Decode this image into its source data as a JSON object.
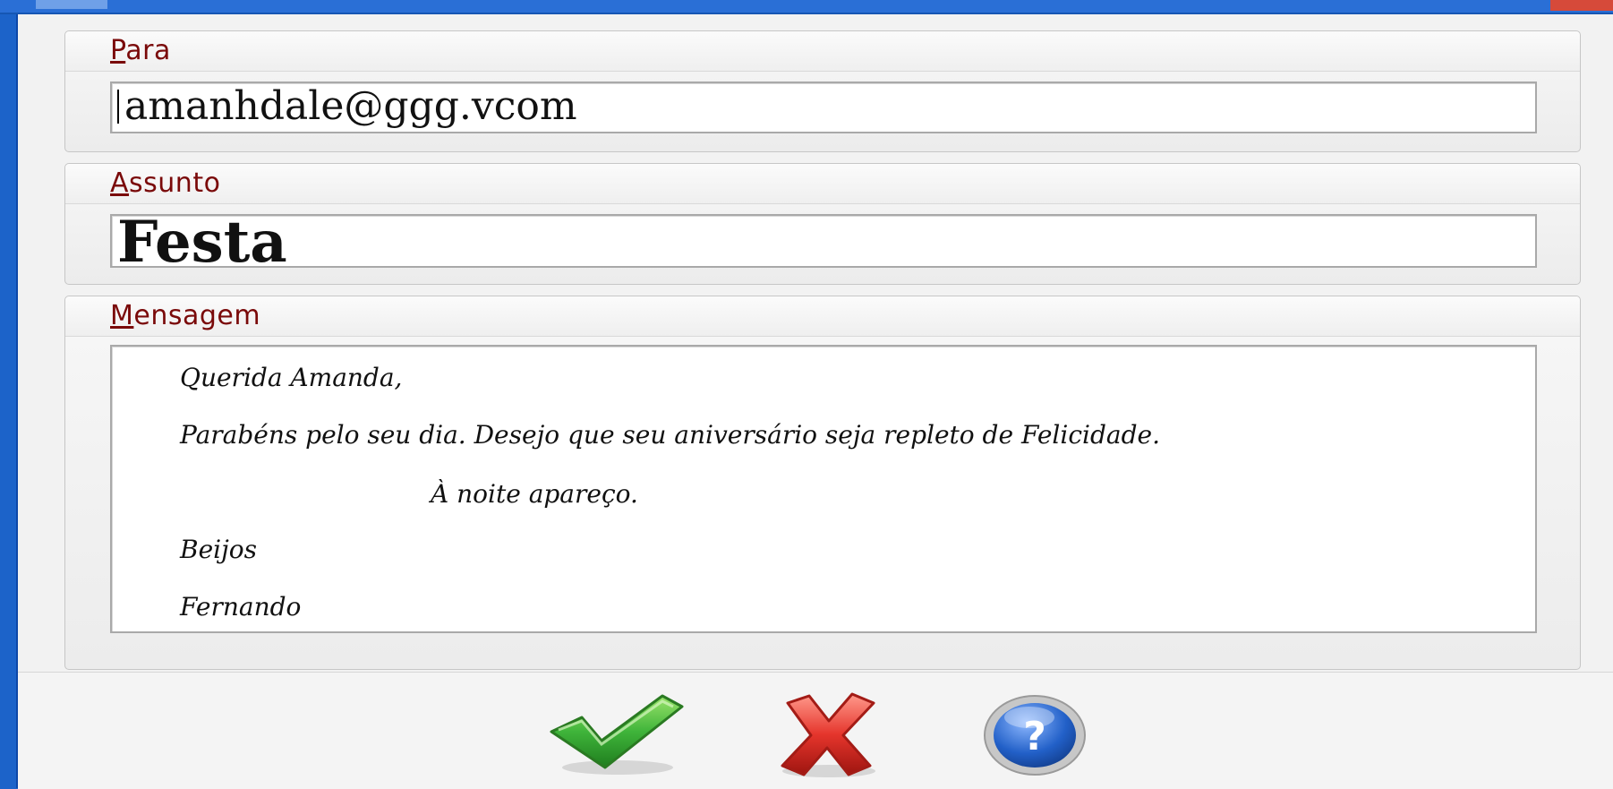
{
  "form": {
    "para": {
      "label_mnemonic": "P",
      "label_rest": "ara",
      "value": "amanhdale@ggg.vcom"
    },
    "assunto": {
      "label_mnemonic": "A",
      "label_rest": "ssunto",
      "value": "Festa"
    },
    "mensagem": {
      "label_mnemonic": "M",
      "label_rest": "ensagem",
      "lines": [
        "Querida Amanda,",
        "Parabéns pelo seu dia. Desejo que seu aniversário seja repleto de Felicidade.",
        "À noite apareço.",
        "Beijos",
        "Fernando"
      ]
    }
  },
  "buttons": {
    "ok_icon": "green-checkmark-icon",
    "cancel_icon": "red-x-icon",
    "help_icon": "blue-question-icon"
  },
  "colors": {
    "label": "#7a0a0a",
    "window_border": "#1c63c9",
    "ok": "#2fa12f",
    "cancel": "#d9302a",
    "help": "#1f5fc4"
  }
}
